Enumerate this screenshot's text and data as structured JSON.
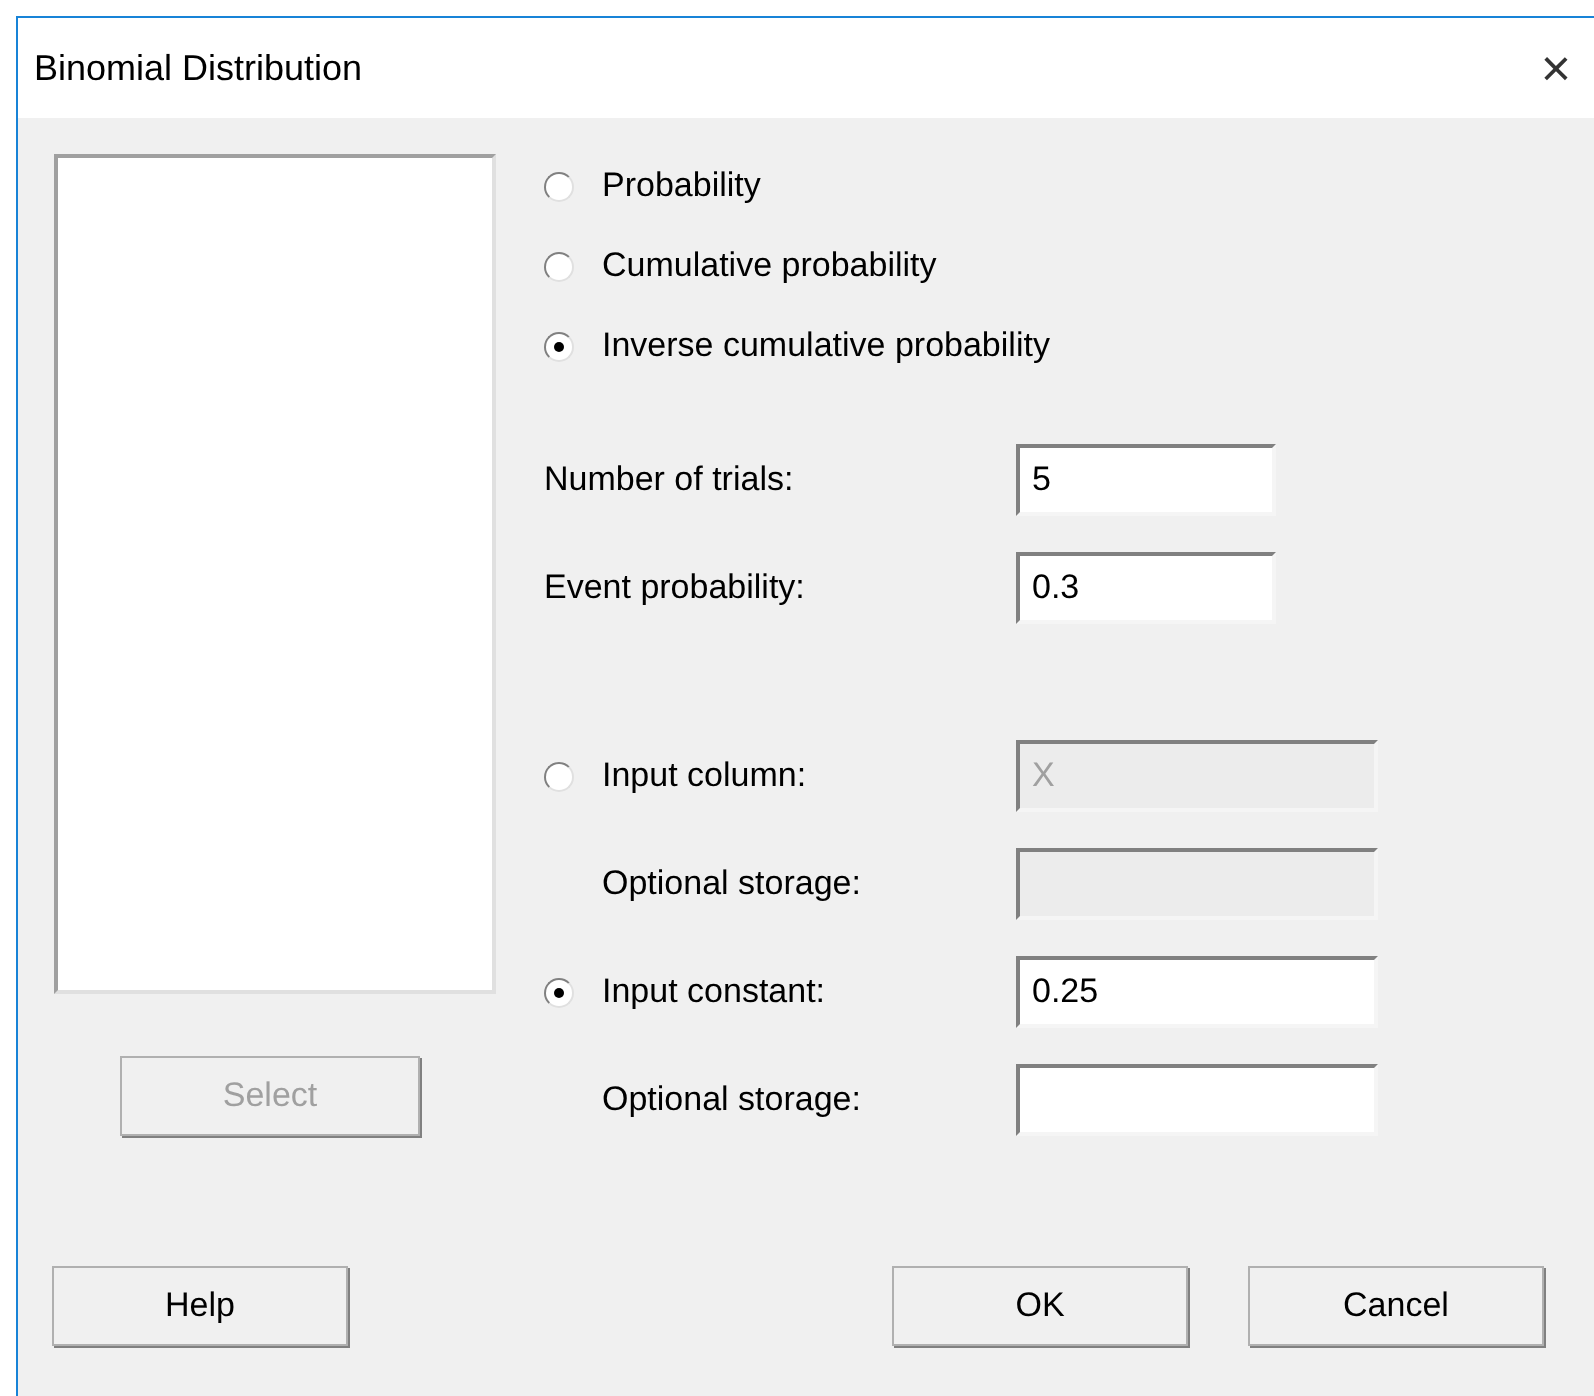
{
  "window": {
    "title": "Binomial Distribution",
    "close": "×"
  },
  "modes": [
    {
      "label": "Probability",
      "selected": false
    },
    {
      "label": "Cumulative probability",
      "selected": false
    },
    {
      "label": "Inverse cumulative probability",
      "selected": true
    }
  ],
  "params": [
    {
      "label": "Number of trials:",
      "value": "5"
    },
    {
      "label": "Event probability:",
      "value": "0.3"
    }
  ],
  "inputs": [
    {
      "label": "Input column:",
      "value": "X",
      "selected": false,
      "disabled": true,
      "storage_label": "Optional storage:"
    },
    {
      "label": "Input constant:",
      "value": "0.25",
      "selected": true,
      "disabled": false,
      "storage_label": "Optional storage:"
    }
  ],
  "select_button": {
    "label": "Select",
    "disabled": true
  },
  "buttons": [
    {
      "label": "Help"
    },
    {
      "label": "OK"
    },
    {
      "label": "Cancel"
    }
  ]
}
